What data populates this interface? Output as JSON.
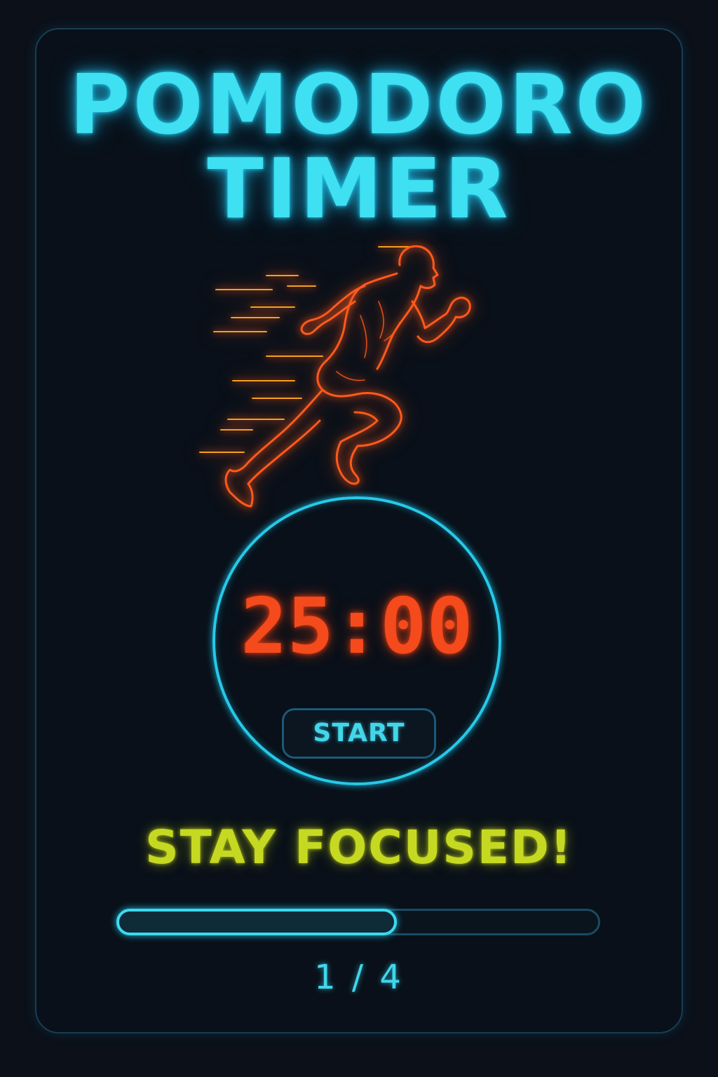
{
  "header": {
    "title_line1": "POMODORO",
    "title_line2": "TIMER"
  },
  "illustration": {
    "icon": "running-man-icon"
  },
  "timer": {
    "time": "25:00",
    "start_label": "START"
  },
  "motto": "STAY FOCUSED!",
  "progress": {
    "label": "1 / 4",
    "completed": 1,
    "total": 4,
    "fill_fraction": 0.58
  },
  "colors": {
    "background": "#0b1019",
    "title": "#3ee0f2",
    "runner": "#ff5a1c",
    "time": "#f44a1c",
    "ring": "#27c9e8",
    "motto": "#c6d922",
    "progress": "#3fd9ee"
  }
}
